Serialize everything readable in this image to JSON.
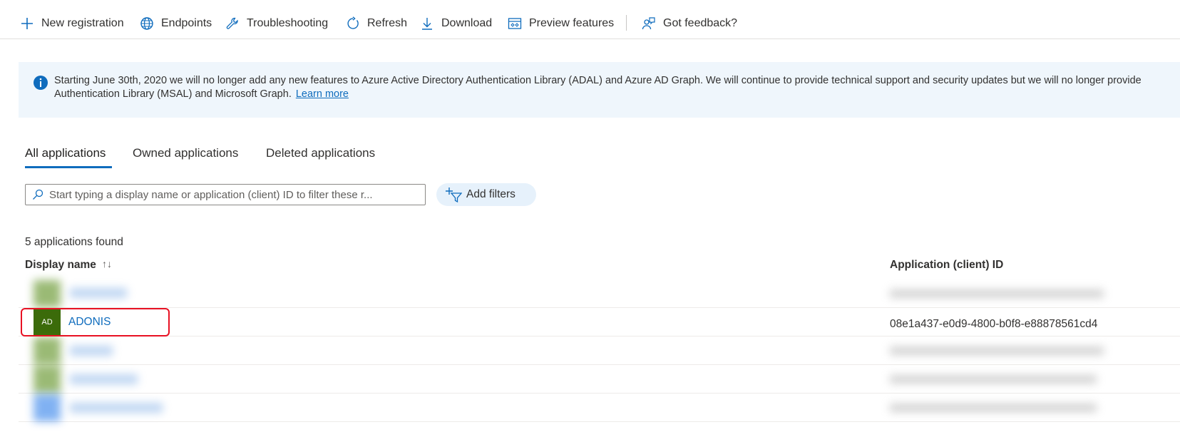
{
  "toolbar": {
    "new_registration": "New registration",
    "endpoints": "Endpoints",
    "troubleshooting": "Troubleshooting",
    "refresh": "Refresh",
    "download": "Download",
    "preview_features": "Preview features",
    "got_feedback": "Got feedback?"
  },
  "banner": {
    "line1": "Starting June 30th, 2020 we will no longer add any new features to Azure Active Directory Authentication Library (ADAL) and Azure AD Graph. We will continue to provide technical support and security updates but we will no longer provide",
    "line2": "Authentication Library (MSAL) and Microsoft Graph.",
    "learn_more": "Learn more"
  },
  "tabs": [
    "All applications",
    "Owned applications",
    "Deleted applications"
  ],
  "search": {
    "placeholder": "Start typing a display name or application (client) ID to filter these r..."
  },
  "add_filters_label": "Add filters",
  "results_count": "5 applications found",
  "table": {
    "col_display_name": "Display name",
    "sort_indicator": "↑↓",
    "col_client_id": "Application (client) ID",
    "rows": [
      {
        "initials": "",
        "name": "",
        "client_id": "",
        "blurred": true,
        "color": "#498205"
      },
      {
        "initials": "AD",
        "name": "ADONIS",
        "client_id": "08e1a437-e0d9-4800-b0f8-e88878561cd4",
        "blurred": false,
        "color": "#3b6b0a"
      },
      {
        "initials": "",
        "name": "",
        "client_id": "",
        "blurred": true,
        "color": "#498205"
      },
      {
        "initials": "",
        "name": "",
        "client_id": "",
        "blurred": true,
        "color": "#498205"
      },
      {
        "initials": "",
        "name": "",
        "client_id": "",
        "blurred": true,
        "color": "#1a73e8"
      }
    ]
  },
  "colors": {
    "accent": "#0f6cbd",
    "banner_bg": "#eff6fc",
    "highlight": "#e81123"
  }
}
